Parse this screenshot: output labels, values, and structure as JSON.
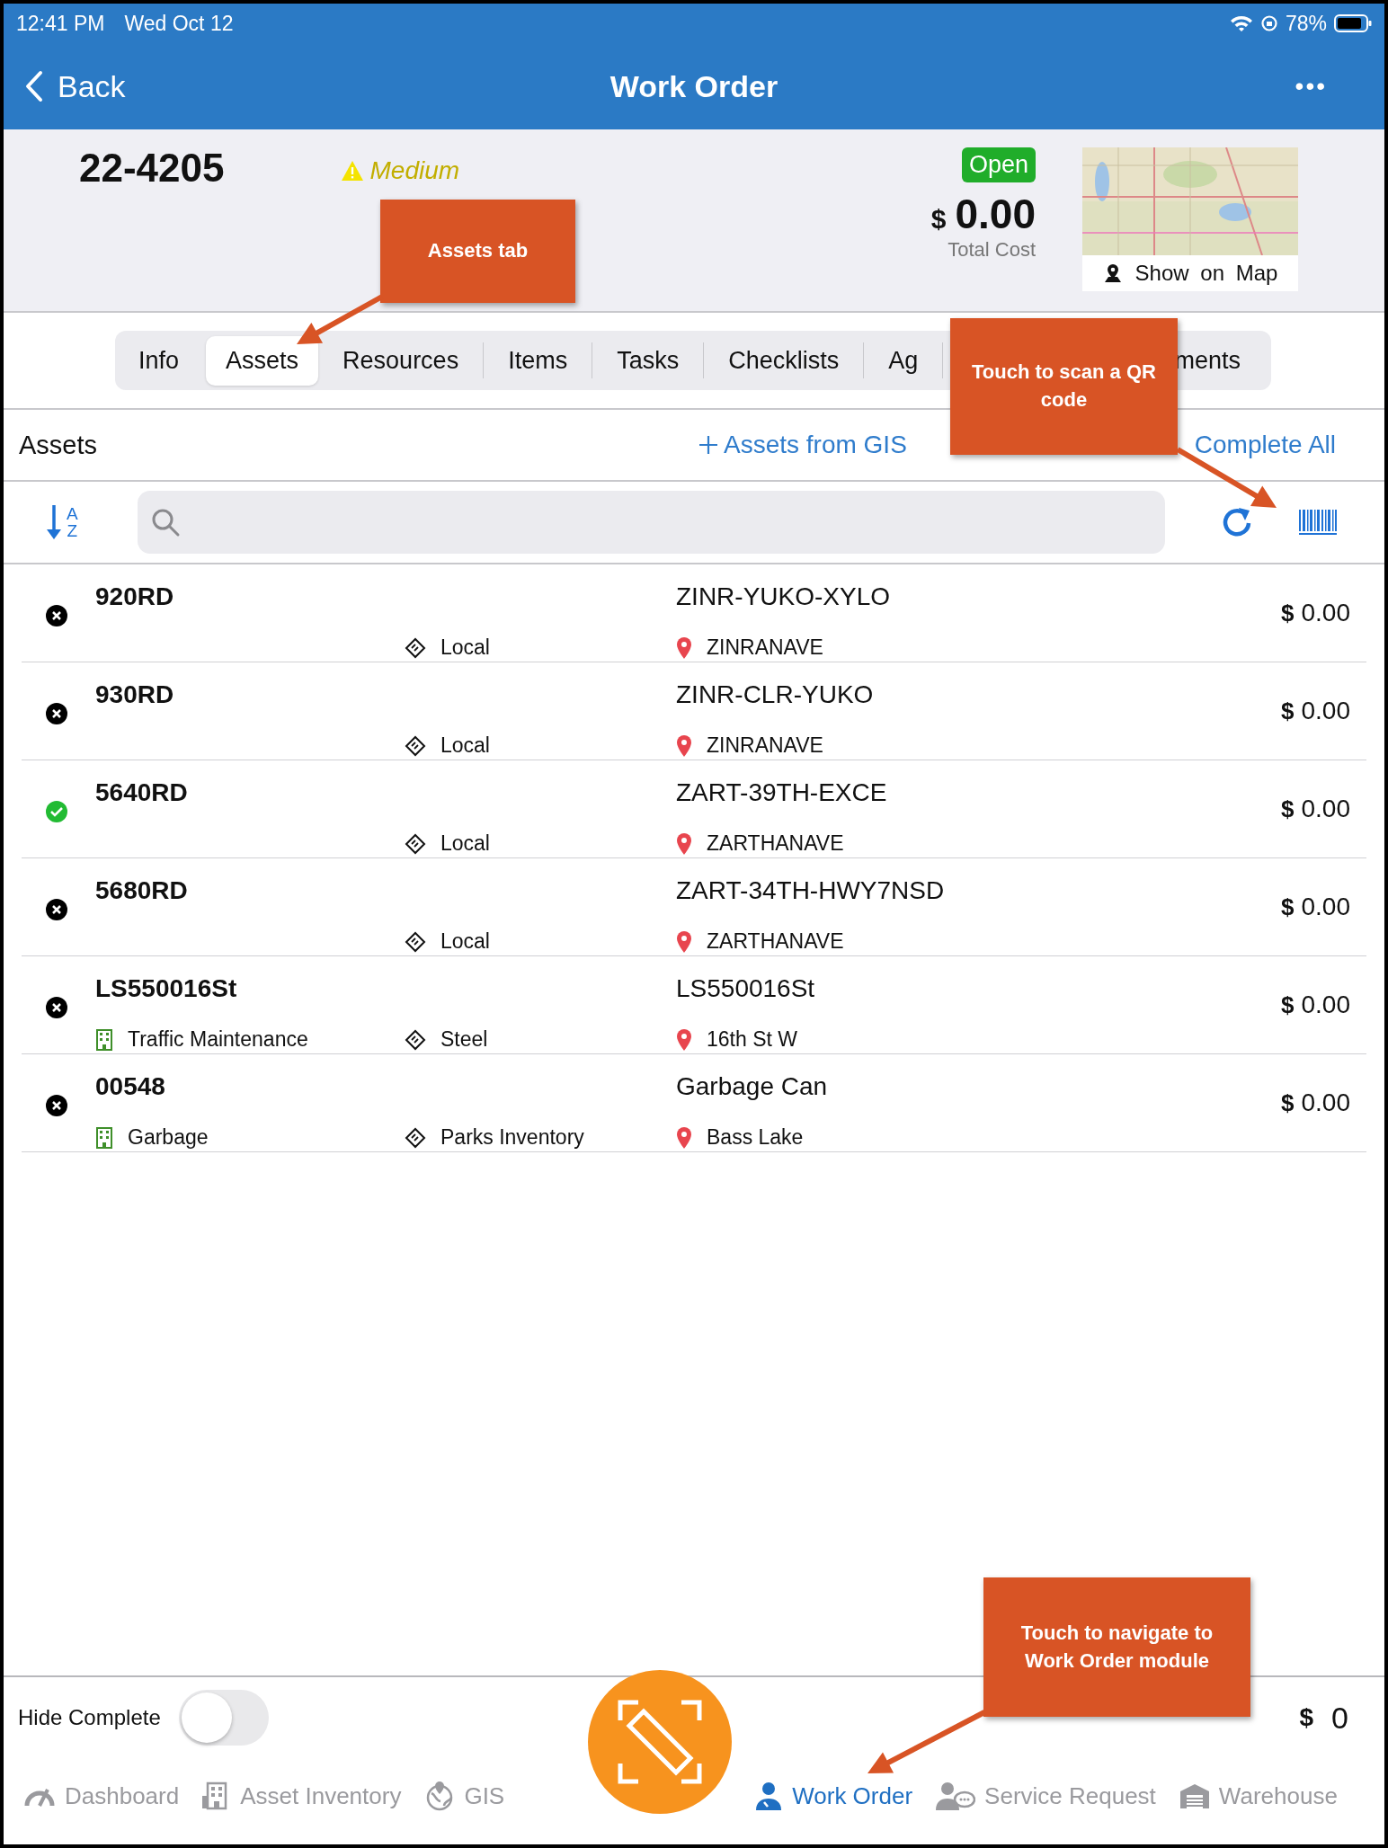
{
  "status_bar": {
    "time": "12:41 PM",
    "date": "Wed Oct 12",
    "battery": "78%"
  },
  "nav_bar": {
    "back": "Back",
    "title": "Work Order",
    "more": "•••"
  },
  "header": {
    "number": "22-4205",
    "priority": "Medium",
    "status": "Open",
    "currency": "$",
    "total": "0.00",
    "total_label": "Total Cost",
    "map_button": "Show on Map"
  },
  "tabs": [
    {
      "label": "Info",
      "selected": false
    },
    {
      "label": "Assets",
      "selected": true
    },
    {
      "label": "Resources",
      "selected": false
    },
    {
      "label": "Items",
      "selected": false
    },
    {
      "label": "Tasks",
      "selected": false
    },
    {
      "label": "Checklists",
      "selected": false
    },
    {
      "label": "Ag",
      "selected": false
    },
    {
      "label": "ments",
      "selected": false
    }
  ],
  "sort_button": {
    "top": "A",
    "bottom": "Z"
  },
  "section": {
    "title": "Assets",
    "add_from_gis": "Assets from GIS",
    "complete_all": "Complete All"
  },
  "assets": [
    {
      "complete": false,
      "name": "920RD",
      "type": "Local",
      "description": "ZINR-YUKO-XYLO",
      "location": "ZINRANAVE",
      "currency": "$",
      "cost": "0.00"
    },
    {
      "complete": false,
      "name": "930RD",
      "type": "Local",
      "description": "ZINR-CLR-YUKO",
      "location": "ZINRANAVE",
      "currency": "$",
      "cost": "0.00"
    },
    {
      "complete": true,
      "name": "5640RD",
      "type": "Local",
      "description": "ZART-39TH-EXCE",
      "location": "ZARTHANAVE",
      "currency": "$",
      "cost": "0.00"
    },
    {
      "complete": false,
      "name": "5680RD",
      "type": "Local",
      "description": "ZART-34TH-HWY7NSD",
      "location": "ZARTHANAVE",
      "currency": "$",
      "cost": "0.00"
    },
    {
      "complete": false,
      "name": "LS550016St",
      "category": "Traffic Maintenance",
      "type": "Steel",
      "description": "LS550016St",
      "location": "16th St W",
      "currency": "$",
      "cost": "0.00"
    },
    {
      "complete": false,
      "name": "00548",
      "category": "Garbage",
      "type": "Parks Inventory",
      "description": "Garbage Can",
      "location": "Bass Lake",
      "currency": "$",
      "cost": "0.00"
    }
  ],
  "footer": {
    "hide_complete_label": "Hide Complete",
    "hide_complete_on": false,
    "currency": "$",
    "total": "0"
  },
  "bottom_nav": [
    {
      "kind": "dashboard",
      "label": "Dashboard",
      "selected": false
    },
    {
      "kind": "inventory",
      "label": "Asset Inventory",
      "selected": false
    },
    {
      "kind": "gis",
      "label": "GIS",
      "selected": false
    },
    {
      "kind": "workorder",
      "label": "Work Order",
      "selected": true
    },
    {
      "kind": "service",
      "label": "Service Request",
      "selected": false
    },
    {
      "kind": "warehouse",
      "label": "Warehouse",
      "selected": false
    }
  ],
  "callouts": [
    {
      "text": "Assets tab"
    },
    {
      "text": "Touch to scan a QR code"
    },
    {
      "text": "Touch to navigate to Work Order module"
    }
  ]
}
